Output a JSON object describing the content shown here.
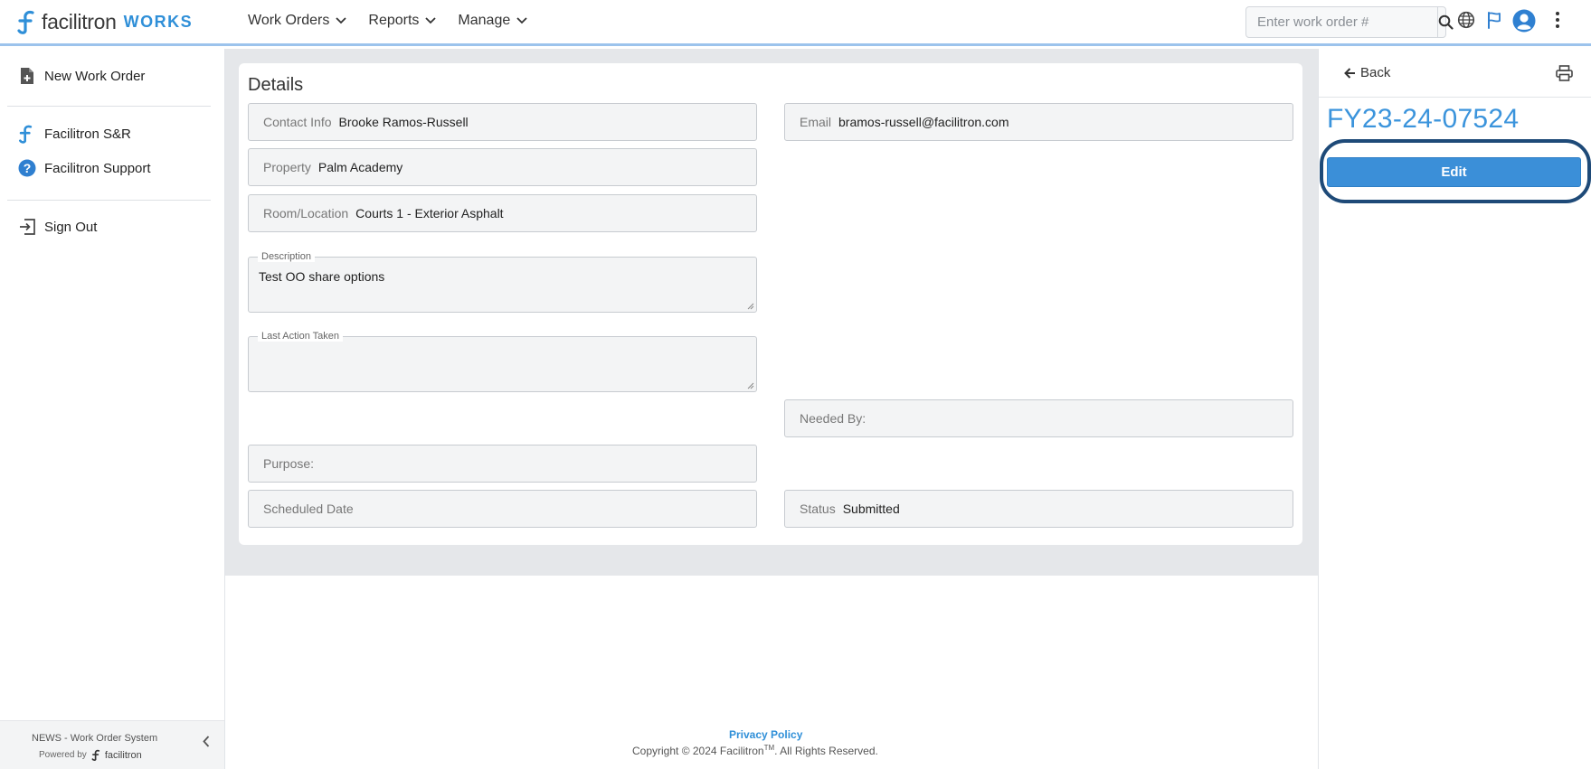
{
  "header": {
    "logo_text": "facilitron",
    "logo_suffix": "WORKS",
    "nav": [
      {
        "label": "Work Orders"
      },
      {
        "label": "Reports"
      },
      {
        "label": "Manage"
      }
    ],
    "search_placeholder": "Enter work order #",
    "icons": [
      "search-icon",
      "globe-icon",
      "flag-icon",
      "user-avatar-icon",
      "more-vertical-icon"
    ]
  },
  "sidebar": {
    "items": [
      {
        "label": "New Work Order",
        "icon": "new-document-icon"
      },
      {
        "label": "Facilitron S&R",
        "icon": "facilitron-logo-icon"
      },
      {
        "label": "Facilitron Support",
        "icon": "help-circle-icon"
      },
      {
        "label": "Sign Out",
        "icon": "sign-out-icon"
      }
    ],
    "footer": {
      "system_name": "NEWS - Work Order System",
      "powered_by": "Powered by",
      "brand": "facilitron"
    }
  },
  "details": {
    "title": "Details",
    "contact": {
      "label": "Contact Info",
      "value": "Brooke Ramos-Russell"
    },
    "email": {
      "label": "Email",
      "value": "bramos-russell@facilitron.com"
    },
    "property": {
      "label": "Property",
      "value": "Palm Academy"
    },
    "room": {
      "label": "Room/Location",
      "value": "Courts 1 - Exterior Asphalt"
    },
    "description": {
      "label": "Description",
      "value": "Test OO share options"
    },
    "last_action": {
      "label": "Last Action Taken",
      "value": ""
    },
    "needed_by": {
      "label": "Needed By:",
      "value": ""
    },
    "purpose": {
      "label": "Purpose:",
      "value": ""
    },
    "scheduled": {
      "label": "Scheduled Date",
      "value": ""
    },
    "status": {
      "label": "Status",
      "value": "Submitted"
    }
  },
  "footer": {
    "privacy": "Privacy Policy",
    "copyright_pre": "Copyright © 2024 Facilitron",
    "tm": "TM",
    "copyright_post": ". All Rights Reserved."
  },
  "right_panel": {
    "back_label": "Back",
    "work_order_number": "FY23-24-07524",
    "edit_label": "Edit"
  },
  "colors": {
    "accent": "#3b8fd8",
    "focus_ring": "#1e4a78",
    "header_border": "#9cc3ec"
  }
}
